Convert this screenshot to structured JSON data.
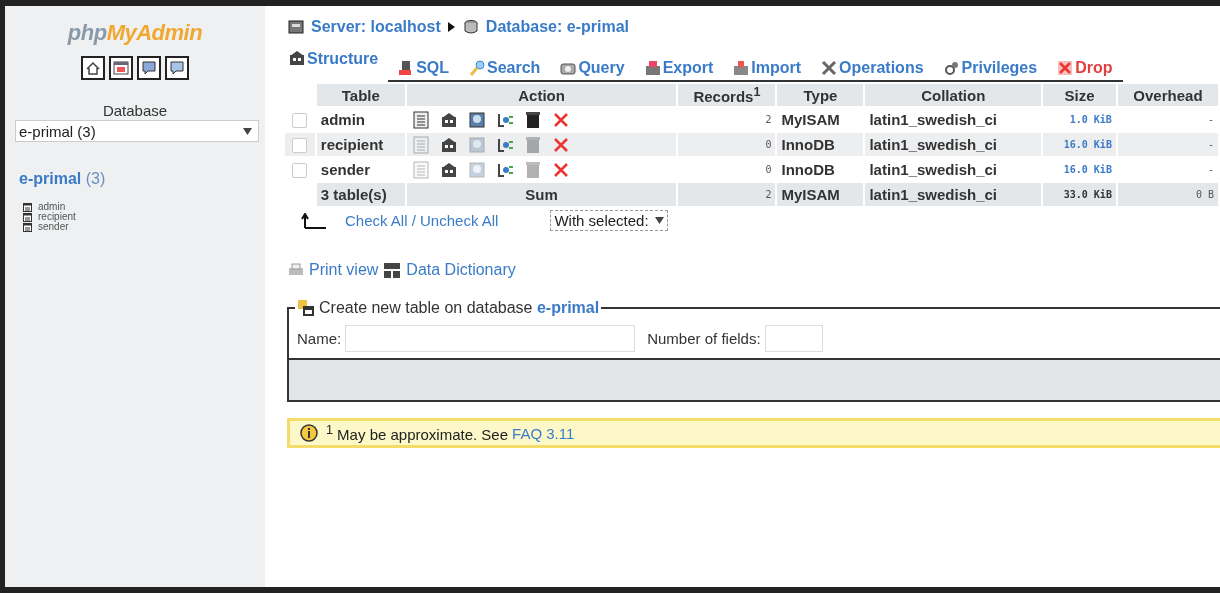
{
  "sidebar": {
    "logo": {
      "part_1": "php",
      "part_2": "MyAdmin"
    },
    "database_label": "Database",
    "database_select": {
      "value": "e-primal (3)"
    },
    "database_link": {
      "name": "e-primal",
      "count": "(3)"
    },
    "tables": [
      "admin",
      "recipient",
      "sender"
    ]
  },
  "breadcrumb": {
    "server": "Server: localhost",
    "database": "Database: e-primal"
  },
  "tabs": [
    {
      "label": "Structure",
      "kind": "structure",
      "selected": true
    },
    {
      "label": "SQL",
      "kind": "sql",
      "selected": false
    },
    {
      "label": "Search",
      "kind": "search",
      "selected": false
    },
    {
      "label": "Query",
      "kind": "query",
      "selected": false
    },
    {
      "label": "Export",
      "kind": "export",
      "selected": false
    },
    {
      "label": "Import",
      "kind": "import",
      "selected": false
    },
    {
      "label": "Operations",
      "kind": "operations",
      "selected": false
    },
    {
      "label": "Privileges",
      "kind": "privileges",
      "selected": false
    },
    {
      "label": "Drop",
      "kind": "drop",
      "selected": false
    }
  ],
  "table": {
    "columns": [
      "Table",
      "Action",
      "Records$^{1}$",
      "Type",
      "Collation",
      "Size",
      "Overhead"
    ],
    "rows": [
      {
        "name": "admin",
        "checked": false,
        "has_records": true,
        "records": "2",
        "type": "MyISAM",
        "collation": "latin1_swedish_ci",
        "size": "1.0 KiB",
        "overhead": "-"
      },
      {
        "name": "recipient",
        "checked": false,
        "has_records": false,
        "records": "0",
        "type": "InnoDB",
        "collation": "latin1_swedish_ci",
        "size": "16.0 KiB",
        "overhead": "-"
      },
      {
        "name": "sender",
        "checked": false,
        "has_records": false,
        "records": "0",
        "type": "InnoDB",
        "collation": "latin1_swedish_ci",
        "size": "16.0 KiB",
        "overhead": "-"
      }
    ],
    "sum": {
      "tables": "3 table(s)",
      "label": "Sum",
      "records": "2",
      "type": "MyISAM",
      "collation": "latin1_swedish_ci",
      "size": "33.0 KiB",
      "overhead": "0 B"
    }
  },
  "check_all": "Check All / Uncheck All",
  "with_selected": {
    "value": "With selected:"
  },
  "links": {
    "print_view": "Print view",
    "data_dictionary": "Data Dictionary"
  },
  "create_table": {
    "legend": "Create new table on database ",
    "database": "e-primal",
    "name_label": "Name:",
    "fields_label": "Number of fields:"
  },
  "notice": {
    "text": "$^{1}$ May be approximate. See",
    "link": "FAQ 3.11"
  }
}
